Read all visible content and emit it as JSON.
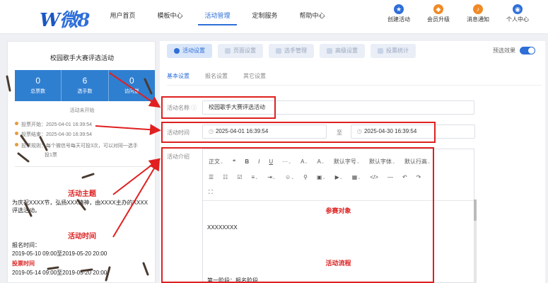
{
  "logo": {
    "w": "W",
    "text": "微8"
  },
  "nav": [
    "用户首页",
    "模板中心",
    "活动管理",
    "定制服务",
    "帮助中心"
  ],
  "nav_active_index": 2,
  "tools": [
    {
      "label": "创建活动",
      "icon": "star-icon",
      "glyph": "★",
      "color": "#2e6fd8"
    },
    {
      "label": "会员升级",
      "icon": "vip-icon",
      "glyph": "◆",
      "color": "#f08a24"
    },
    {
      "label": "消息通知",
      "icon": "bell-icon",
      "glyph": "♪",
      "color": "#f08a24"
    },
    {
      "label": "个人中心",
      "icon": "user-icon",
      "glyph": "◉",
      "color": "#2e6fd8"
    }
  ],
  "preview": {
    "title": "校园歌手大赛评选活动",
    "stats": [
      {
        "value": "0",
        "label": "总票数"
      },
      {
        "value": "6",
        "label": "选手数"
      },
      {
        "value": "0",
        "label": "访问量"
      }
    ],
    "status": "活动未开始",
    "vote_start": "投票开始：2025-04-01 16:39:54",
    "vote_end": "投票结束：2025-04-30 16:39:54",
    "vote_rule_1": "投票规则：每个微信号每天可投3次，可以对同一选手",
    "vote_rule_2": "投1票",
    "section1_title": "活动主题",
    "section1_text": "为庆祝XXXX节，弘扬XXX精神，由XXXX主办的XXXX评选活动。",
    "section2_title": "活动时间",
    "signup_label": "报名时间：",
    "signup_range": "2019-05-10 09:00至2019-05-20 20:00",
    "vote_label": "投票时间",
    "vote_range": "2019-05-14 09:00至2019-05-20 20:00"
  },
  "steps": [
    "活动设置",
    "页面设置",
    "选手管理",
    "高级设置",
    "投票统计"
  ],
  "preview_toggle": "预选效果",
  "subtabs": [
    "基本设置",
    "报名设置",
    "其它设置"
  ],
  "form": {
    "name_label": "活动名称",
    "name_value": "校园歌手大赛评选活动",
    "time_label": "活动时间",
    "start": "2025-04-01 16:39:54",
    "to": "至",
    "end": "2025-04-30 16:39:54",
    "intro_label": "活动介绍"
  },
  "toolbar": {
    "row1": [
      "正文",
      "❝",
      "B",
      "I",
      "U",
      "···",
      "A",
      "A",
      "默认字号",
      "默认字体",
      "默认行高"
    ],
    "row2": [
      "☰",
      "☷",
      "☑",
      "≡",
      "⇥",
      "☺",
      "⚲",
      "▣",
      "▶",
      "▦",
      "</>",
      "—",
      "↶",
      "↷"
    ],
    "row3": [
      "⛶"
    ]
  },
  "content": {
    "h1": "参赛对象",
    "p1": "XXXXXXXX",
    "h2": "活动流程",
    "p2": "第一阶段：报名阶段"
  }
}
